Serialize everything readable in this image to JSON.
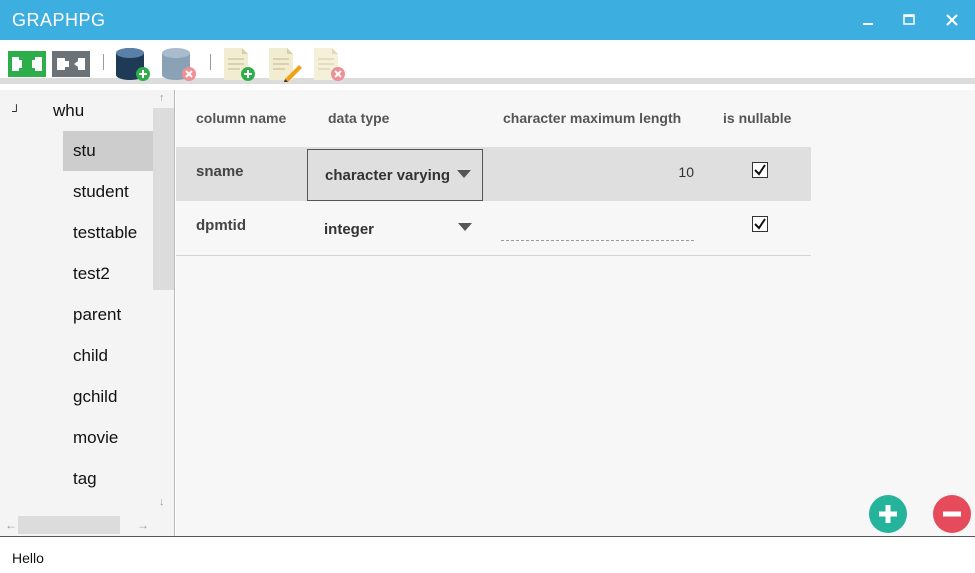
{
  "window": {
    "title": "GRAPHPG",
    "controls": {
      "minimize": "minimize-icon",
      "maximize": "maximize-icon",
      "close": "close-icon"
    }
  },
  "toolbar": {
    "buttons": [
      {
        "icon": "connect-icon",
        "color": "#2eae4a"
      },
      {
        "icon": "disconnect-icon",
        "color": "#6b7378"
      },
      {
        "icon": "database-add-icon",
        "color": "#1f3a57"
      },
      {
        "icon": "database-remove-icon",
        "color": "#8aa1b6"
      },
      {
        "icon": "table-add-icon",
        "color": "#e8dfb8"
      },
      {
        "icon": "table-edit-icon",
        "color": "#e8dfb8"
      },
      {
        "icon": "table-delete-icon",
        "color": "#e8dfb8"
      }
    ]
  },
  "tree": {
    "root": {
      "toggle": "┘",
      "label": "whu"
    },
    "items": [
      "stu",
      "student",
      "testtable",
      "test2",
      "parent",
      "child",
      "gchild",
      "movie",
      "tag"
    ],
    "selected": "stu"
  },
  "grid": {
    "columns": [
      "column name",
      "data type",
      "character maximum length",
      "is nullable"
    ],
    "rows": [
      {
        "name": "sname",
        "type": "character varying",
        "max_length": "10",
        "nullable": true
      },
      {
        "name": "dpmtid",
        "type": "integer",
        "max_length": "",
        "nullable": true
      }
    ]
  },
  "actions": {
    "add_icon": "add-circle-icon",
    "remove_icon": "remove-circle-icon"
  },
  "status": {
    "text": "Hello"
  },
  "colors": {
    "titlebar": "#3daee0",
    "add": "#26b39c",
    "remove": "#e54b5b"
  }
}
